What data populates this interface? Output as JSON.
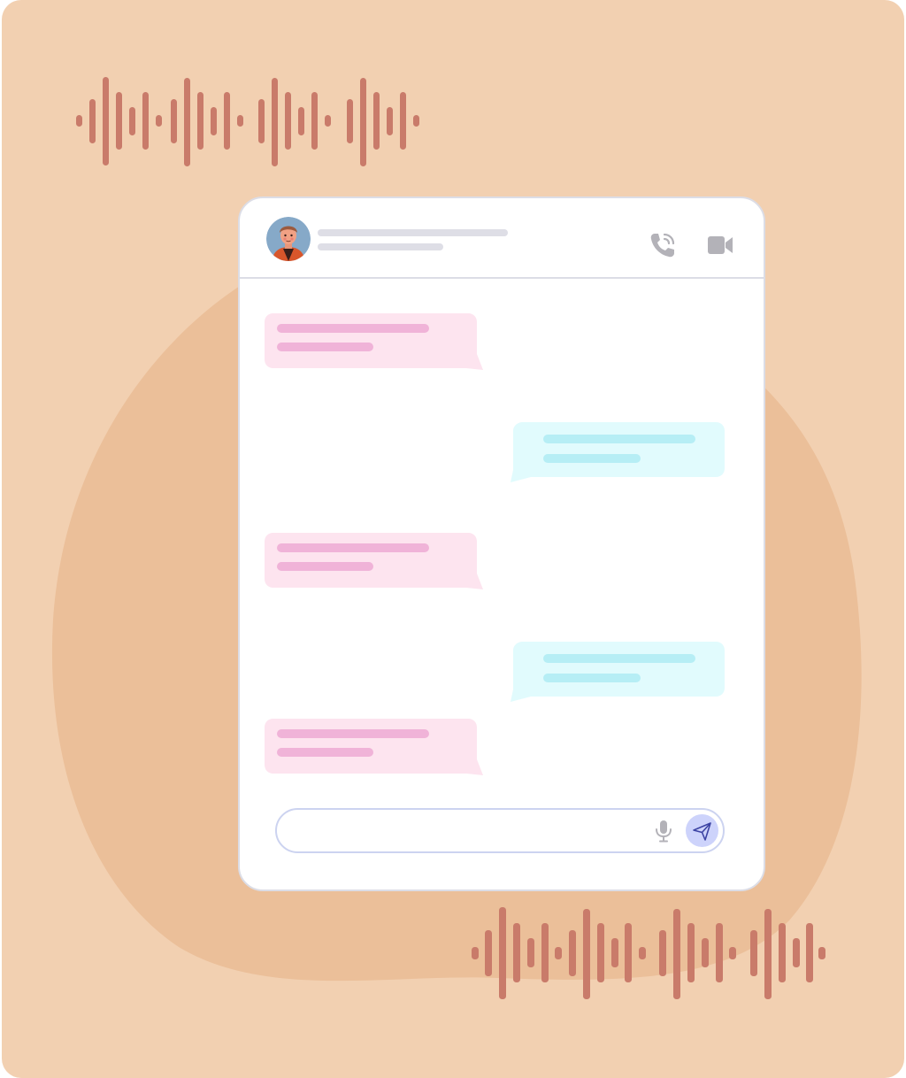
{
  "colors": {
    "background": "#f2d0b1",
    "blob": "#ebbf99",
    "waveform": "#c97b6a",
    "window_border": "#dcdde6",
    "placeholder_line": "#dedee6",
    "incoming_bubble": "#fde4ef",
    "incoming_line": "#f0b3d8",
    "outgoing_bubble": "#e1fbfd",
    "outgoing_line": "#b6eef5",
    "icon_gray": "#b3b2b8",
    "send_button": "#cdd3fb",
    "send_icon": "#3d44a4"
  },
  "header": {
    "avatar_icon": "person-avatar",
    "call_icon": "phone-call-icon",
    "video_icon": "video-camera-icon"
  },
  "messages": [
    {
      "direction": "incoming"
    },
    {
      "direction": "outgoing"
    },
    {
      "direction": "incoming"
    },
    {
      "direction": "outgoing"
    },
    {
      "direction": "incoming"
    }
  ],
  "composer": {
    "placeholder": "",
    "mic_icon": "microphone-icon",
    "send_icon": "send-icon"
  }
}
